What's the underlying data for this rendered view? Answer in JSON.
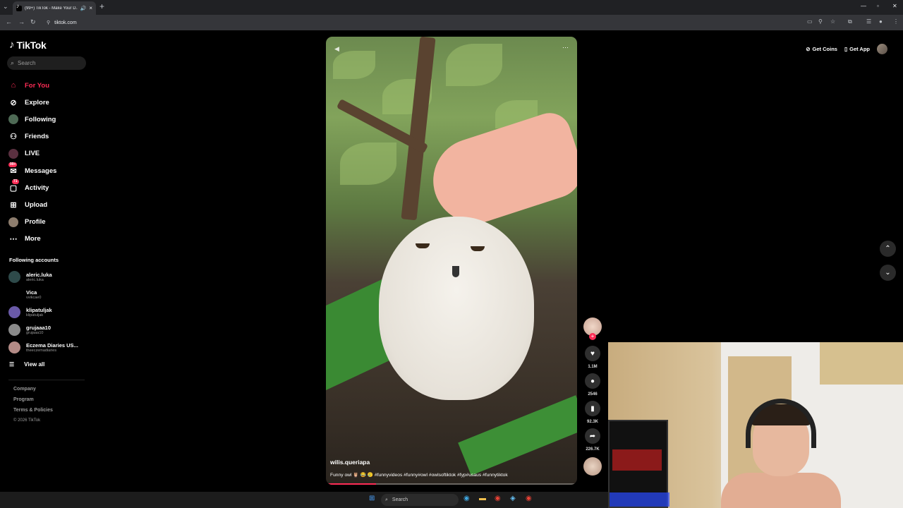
{
  "browser": {
    "tab_title": "(99+) TikTok - Make Your D...",
    "url": "tiktok.com"
  },
  "brand": {
    "name": "TikTok"
  },
  "search": {
    "placeholder": "Search"
  },
  "nav": [
    {
      "label": "For You",
      "icon": "home-icon",
      "active": true
    },
    {
      "label": "Explore",
      "icon": "compass-icon"
    },
    {
      "label": "Following",
      "icon": "following-avatar-icon"
    },
    {
      "label": "Friends",
      "icon": "friends-icon"
    },
    {
      "label": "LIVE",
      "icon": "live-icon"
    },
    {
      "label": "Messages",
      "icon": "messages-icon",
      "badge": "99+"
    },
    {
      "label": "Activity",
      "icon": "activity-icon",
      "badge": "71"
    },
    {
      "label": "Upload",
      "icon": "upload-icon"
    },
    {
      "label": "Profile",
      "icon": "profile-avatar-icon"
    },
    {
      "label": "More",
      "icon": "more-dots-icon"
    }
  ],
  "following_title": "Following accounts",
  "accounts": [
    {
      "name": "aleric.luka",
      "handle": "aleric.luka"
    },
    {
      "name": "Vica",
      "handle": "vvikcae0"
    },
    {
      "name": "klipatuljak",
      "handle": "klipatuljak"
    },
    {
      "name": "grujaaa10",
      "handle": "grujaaa10"
    },
    {
      "name": "Eczema Diaries US...",
      "handle": "theeczemadiaries"
    }
  ],
  "view_all": "View all",
  "footer": {
    "company": "Company",
    "program": "Program",
    "terms": "Terms & Policies",
    "copyright": "© 2026 TikTok"
  },
  "topright": {
    "get_coins": "Get Coins",
    "get_app": "Get App"
  },
  "video": {
    "username": "wilis.queriapa",
    "caption": "Funny owl 🦉 😂 🥲 #funnyvideos #funny#owl #owlsoftiktok #fyp#usaus #funnytiktok",
    "progress": 0.2
  },
  "actions": {
    "likes": "1.1M",
    "comments": "2546",
    "saves": "92.3K",
    "shares": "226.7K"
  },
  "taskbar": {
    "search_label": "Search"
  },
  "colors": {
    "accent": "#fe2c55",
    "background": "#000000",
    "sidebar_search": "#1f1f1f"
  }
}
